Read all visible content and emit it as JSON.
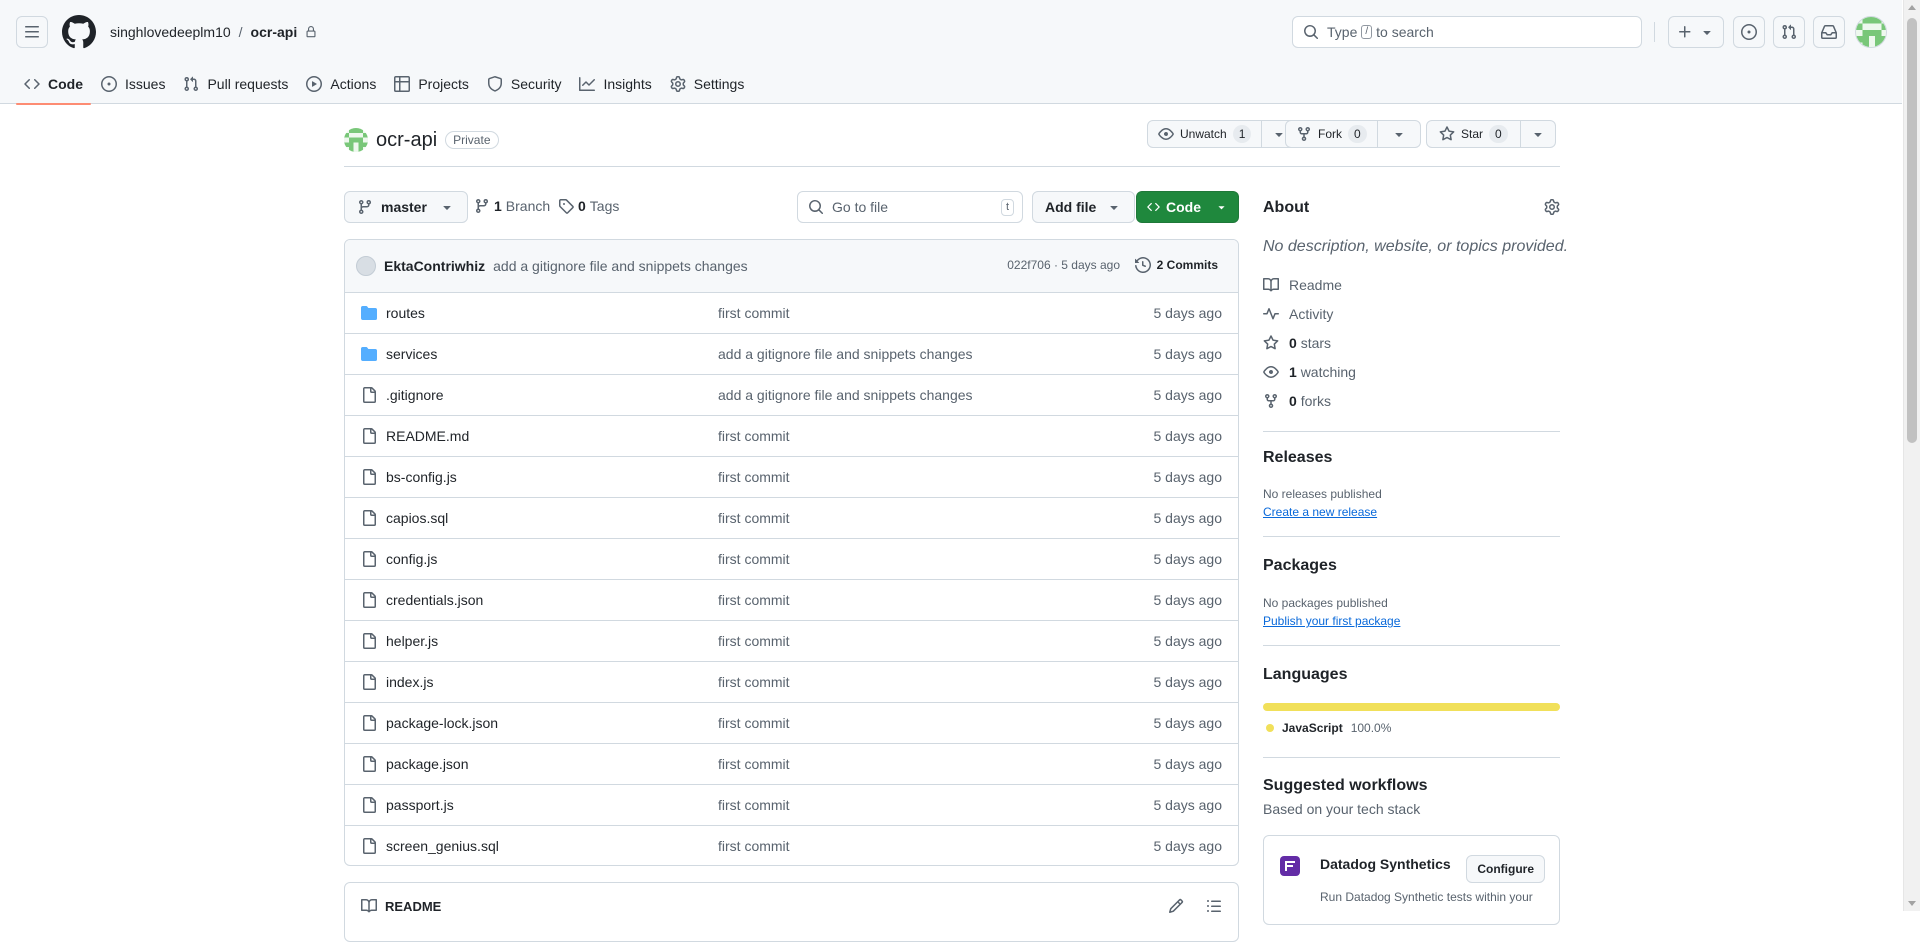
{
  "header": {
    "owner": "singhlovedeeplm10",
    "separator": "/",
    "repo": "ocr-api",
    "search": {
      "prefix": "Type",
      "key": "/",
      "suffix": "to search"
    },
    "icons": [
      "hamburger-icon",
      "github-logo-icon",
      "lock-icon",
      "search-icon",
      "plus-icon",
      "issue-opened-icon",
      "pull-request-icon",
      "inbox-icon"
    ]
  },
  "nav": {
    "tabs": [
      {
        "label": "Code",
        "icon": "code-icon",
        "active": true
      },
      {
        "label": "Issues",
        "icon": "issue-opened-icon"
      },
      {
        "label": "Pull requests",
        "icon": "pull-request-icon"
      },
      {
        "label": "Actions",
        "icon": "play-icon"
      },
      {
        "label": "Projects",
        "icon": "table-icon"
      },
      {
        "label": "Security",
        "icon": "shield-icon"
      },
      {
        "label": "Insights",
        "icon": "graph-icon"
      },
      {
        "label": "Settings",
        "icon": "gear-icon"
      }
    ]
  },
  "repo": {
    "name": "ocr-api",
    "visibility": "Private",
    "unwatch": {
      "label": "Unwatch",
      "count": "1"
    },
    "fork": {
      "label": "Fork",
      "count": "0"
    },
    "star": {
      "label": "Star",
      "count": "0"
    }
  },
  "toolbar": {
    "branch": "master",
    "branches": {
      "count": "1",
      "label": "Branch"
    },
    "tags": {
      "count": "0",
      "label": "Tags"
    },
    "goto_placeholder": "Go to file",
    "goto_key": "t",
    "add_file": "Add file",
    "code": "Code"
  },
  "commit": {
    "author": "EktaContriwhiz",
    "message": "add a gitignore file and snippets changes",
    "sha_time": "022f706 · 5 days ago",
    "commits": "2 Commits"
  },
  "files": [
    {
      "name": "routes",
      "type": "dir",
      "message": "first commit",
      "date": "5 days ago"
    },
    {
      "name": "services",
      "type": "dir",
      "message": "add a gitignore file and snippets changes",
      "date": "5 days ago"
    },
    {
      "name": ".gitignore",
      "type": "file",
      "message": "add a gitignore file and snippets changes",
      "date": "5 days ago"
    },
    {
      "name": "README.md",
      "type": "file",
      "message": "first commit",
      "date": "5 days ago"
    },
    {
      "name": "bs-config.js",
      "type": "file",
      "message": "first commit",
      "date": "5 days ago"
    },
    {
      "name": "capios.sql",
      "type": "file",
      "message": "first commit",
      "date": "5 days ago"
    },
    {
      "name": "config.js",
      "type": "file",
      "message": "first commit",
      "date": "5 days ago"
    },
    {
      "name": "credentials.json",
      "type": "file",
      "message": "first commit",
      "date": "5 days ago"
    },
    {
      "name": "helper.js",
      "type": "file",
      "message": "first commit",
      "date": "5 days ago"
    },
    {
      "name": "index.js",
      "type": "file",
      "message": "first commit",
      "date": "5 days ago"
    },
    {
      "name": "package-lock.json",
      "type": "file",
      "message": "first commit",
      "date": "5 days ago"
    },
    {
      "name": "package.json",
      "type": "file",
      "message": "first commit",
      "date": "5 days ago"
    },
    {
      "name": "passport.js",
      "type": "file",
      "message": "first commit",
      "date": "5 days ago"
    },
    {
      "name": "screen_genius.sql",
      "type": "file",
      "message": "first commit",
      "date": "5 days ago"
    }
  ],
  "readme": {
    "title": "README"
  },
  "about": {
    "title": "About",
    "description": "No description, website, or topics provided.",
    "links": [
      {
        "icon": "book-icon",
        "strong": "",
        "text": "Readme"
      },
      {
        "icon": "pulse-icon",
        "strong": "",
        "text": "Activity"
      },
      {
        "icon": "star-icon",
        "strong": "0",
        "text": "stars"
      },
      {
        "icon": "eye-icon",
        "strong": "1",
        "text": "watching"
      },
      {
        "icon": "fork-icon",
        "strong": "0",
        "text": "forks"
      }
    ]
  },
  "releases": {
    "title": "Releases",
    "empty": "No releases published",
    "link": "Create a new release"
  },
  "packages": {
    "title": "Packages",
    "empty": "No packages published",
    "link": "Publish your first package"
  },
  "languages": {
    "title": "Languages",
    "items": [
      {
        "name": "JavaScript",
        "percent": "100.0%",
        "share": 1.0,
        "color": "#f1e05a"
      }
    ]
  },
  "workflows": {
    "title": "Suggested workflows",
    "subtitle": "Based on your tech stack",
    "card": {
      "name": "Datadog Synthetics",
      "button": "Configure",
      "description": "Run Datadog Synthetic tests within your"
    }
  },
  "colors": {
    "accent": "#1f883d",
    "tab_underline": "#fd8c73",
    "link": "#0969da",
    "folder": "#54aeff"
  }
}
